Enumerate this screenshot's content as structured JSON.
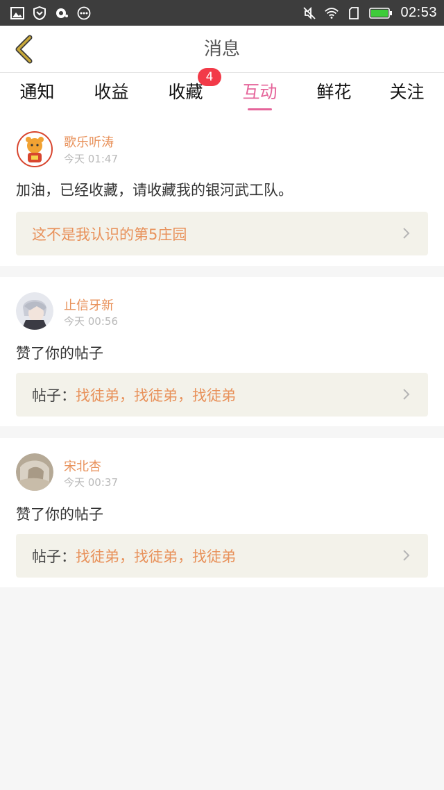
{
  "status_bar": {
    "time": "02:53",
    "icons_left": [
      "image-icon",
      "shield-icon",
      "chat-bubble-icon",
      "more-dots-icon"
    ],
    "icons_right": [
      "mute-icon",
      "wifi-icon",
      "sim-icon",
      "battery-icon"
    ]
  },
  "header": {
    "title": "消息"
  },
  "tabs": [
    {
      "label": "通知"
    },
    {
      "label": "收益"
    },
    {
      "label": "收藏",
      "badge": "4"
    },
    {
      "label": "互动",
      "active": true
    },
    {
      "label": "鲜花"
    },
    {
      "label": "关注"
    }
  ],
  "messages": [
    {
      "user": "歌乐听涛",
      "time": "今天 01:47",
      "text": "加油，已经收藏，请收藏我的银河武工队。",
      "link": {
        "prefix": "",
        "title": "这不是我认识的第5庄园"
      }
    },
    {
      "user": "止信牙新",
      "time": "今天 00:56",
      "text": "赞了你的帖子",
      "link": {
        "prefix": "帖子：",
        "title": "找徒弟，找徒弟，找徒弟"
      }
    },
    {
      "user": "宋北杏",
      "time": "今天 00:37",
      "text": "赞了你的帖子",
      "link": {
        "prefix": "帖子：",
        "title": "找徒弟，找徒弟，找徒弟"
      }
    }
  ],
  "colors": {
    "accent": "#e5649a",
    "username": "#e8915a",
    "badge": "#f23a48",
    "back_arrow": "#c9a93a",
    "link_bg": "#f3f2ea"
  }
}
